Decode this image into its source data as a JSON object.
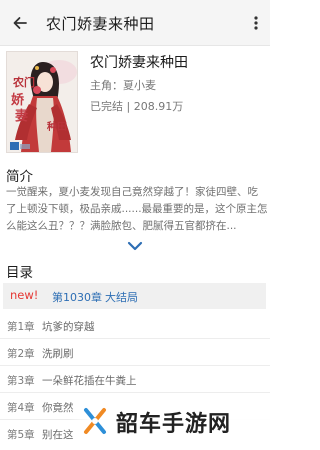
{
  "appbar": {
    "title": "农门娇妻来种田",
    "back_icon": "arrow-left-icon",
    "more_icon": "more-vertical-icon"
  },
  "book": {
    "cover_icon": "book-cover-illustration",
    "cover_text": "农门娇妻来种田",
    "title": "农门娇妻来种田",
    "author": "主角：夏小麦",
    "meta": "已完结 | 208.91万"
  },
  "intro": {
    "heading": "简介",
    "text": "一觉醒来，夏小麦发现自己竟然穿越了！家徒四壁、吃了上顿没下顿，极品亲戚......最最重要的是，这个原主怎么能这么丑？？？满脸脓包、肥腻得五官都挤在...",
    "expand_icon": "chevron-down-icon"
  },
  "toc": {
    "heading": "目录",
    "latest": {
      "badge": "new!",
      "chapter_num": "第1030章",
      "chapter_name": "大结局"
    },
    "chapters": [
      {
        "num": "第1章",
        "name": "坑爹的穿越"
      },
      {
        "num": "第2章",
        "name": "洗刷刷"
      },
      {
        "num": "第3章",
        "name": "一朵鲜花插在牛粪上"
      },
      {
        "num": "第4章",
        "name": "你竟然"
      },
      {
        "num": "第5章",
        "name": "别在这"
      }
    ]
  },
  "watermark": {
    "text": "韶车手游网",
    "icon": "watermark-logo-icon"
  },
  "colors": {
    "accent_blue": "#2d6eb4",
    "new_red": "#e53935",
    "appbar_bg": "#f5f5f5"
  }
}
